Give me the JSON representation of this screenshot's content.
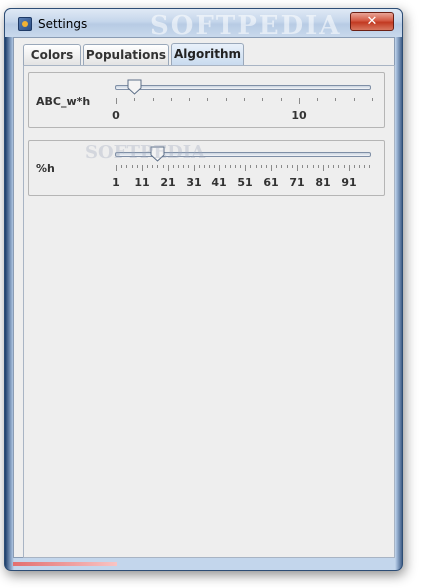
{
  "window": {
    "title": "Settings",
    "watermark": "SOFTPEDIA",
    "close_symbol": "✕"
  },
  "tabs": [
    {
      "label": "Colors",
      "selected": false
    },
    {
      "label": "Populations",
      "selected": false
    },
    {
      "label": "Algorithm",
      "selected": true
    }
  ],
  "sliders": [
    {
      "label": "ABC_w*h",
      "min": 0,
      "max": 14,
      "value": 1,
      "tick_labels": [
        "0",
        "10"
      ]
    },
    {
      "label": "%h",
      "min": 1,
      "max": 100,
      "value": 17,
      "tick_labels": [
        "1",
        "11",
        "21",
        "31",
        "41",
        "51",
        "61",
        "71",
        "81",
        "91"
      ]
    }
  ],
  "overlay_watermark": "SOFTPEDIA",
  "colors": {
    "accent": "#c9dbef",
    "close": "#c23a22"
  }
}
